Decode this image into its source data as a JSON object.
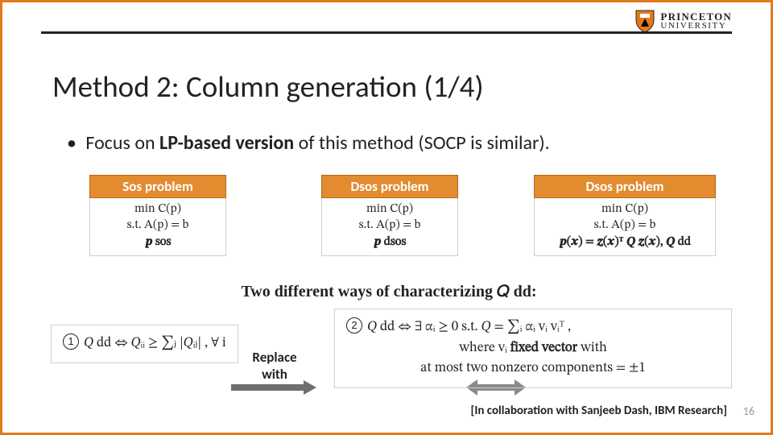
{
  "brand": {
    "line1": "PRINCETON",
    "line2": "UNIVERSITY",
    "shield_color": "#e07a1d"
  },
  "title": "Method 2: Column generation (1/4)",
  "bullet": {
    "dot": "•",
    "pre": " Focus on ",
    "bold": "LP-based version",
    "post": " of this method (SOCP is similar)."
  },
  "replace": {
    "l1": "Replace",
    "l2": "with"
  },
  "problems": {
    "p1": {
      "header": "Sos problem",
      "l1": "min C(p)",
      "l2": "s.t. A(p) = b",
      "l3": "𝒑 sos"
    },
    "p2": {
      "header": "Dsos problem",
      "l1": "min C(p)",
      "l2": "s.t. A(p) = b",
      "l3": "𝒑 dsos"
    },
    "p3": {
      "header": "Dsos problem",
      "l1": "min C(p)",
      "l2": "s.t. A(p) = b",
      "l3": "𝒑(𝒙) = 𝒛(𝒙)ᵀ 𝑸 𝒛(𝒙), 𝑸 dd"
    }
  },
  "two_ways": "Two different ways of characterizing 𝑄 dd:",
  "cond1": {
    "num": "1",
    "text": "𝑄 dd ⇔ 𝑄ᵢᵢ ≥ ∑ⱼ |𝑄ᵢⱼ| , ∀ i"
  },
  "cond2": {
    "num": "2",
    "l1": "𝑄 dd ⇔ ∃ αᵢ ≥ 0 s.t. 𝑄 = ∑ᵢ αᵢ vᵢ vᵢᵀ ,",
    "l2_pre": "where vᵢ ",
    "l2_bold": "fixed vector",
    "l2_post": " with",
    "l3": "at most two nonzero components = ±1"
  },
  "footer": "[In collaboration with Sanjeeb Dash, IBM Research]",
  "page_number": "16"
}
